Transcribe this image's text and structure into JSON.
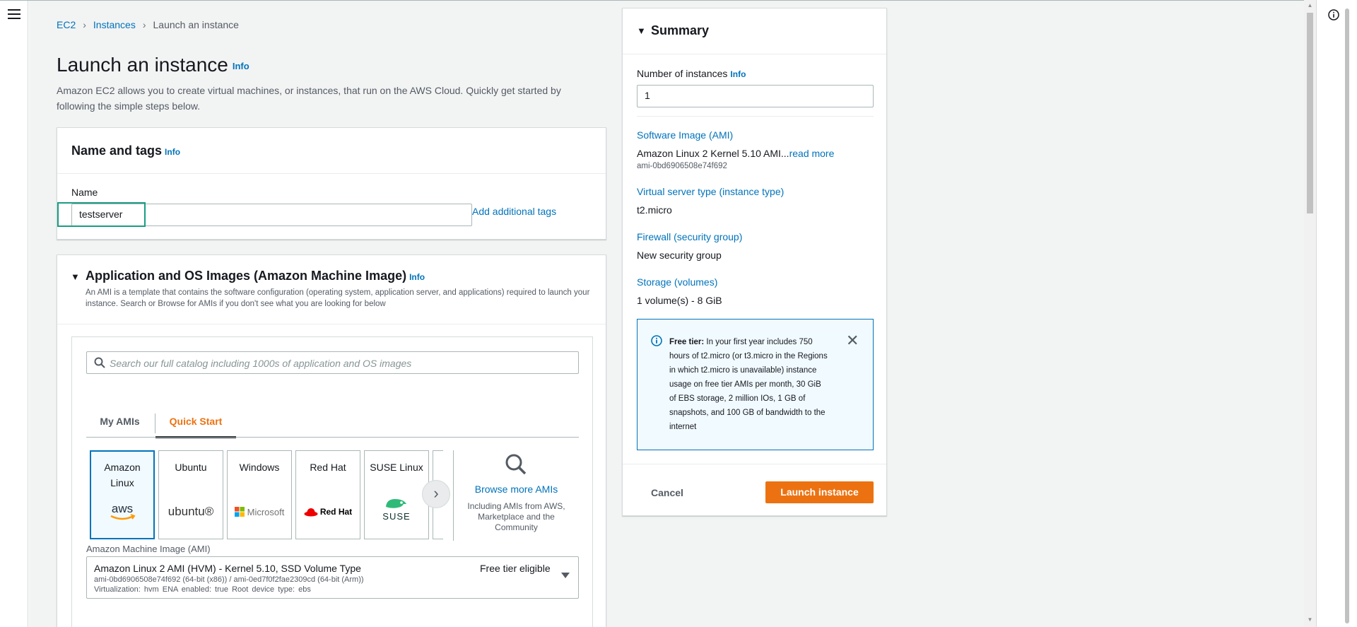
{
  "breadcrumb": {
    "items": [
      "EC2",
      "Instances"
    ],
    "current": "Launch an instance"
  },
  "page": {
    "title": "Launch an instance",
    "info": "Info",
    "intro": "Amazon EC2 allows you to create virtual machines, or instances, that run on the AWS Cloud. Quickly get started by following the simple steps below."
  },
  "name_tags": {
    "title": "Name and tags",
    "info": "Info",
    "name_label": "Name",
    "name_value": "testserver",
    "add_tags": "Add additional tags"
  },
  "ami_section": {
    "title": "Application and OS Images (Amazon Machine Image)",
    "info": "Info",
    "description": "An AMI is a template that contains the software configuration (operating system, application server, and applications) required to launch your instance. Search or Browse for AMIs if you don't see what you are looking for below",
    "search_placeholder": "Search our full catalog including 1000s of application and OS images",
    "tabs": [
      "My AMIs",
      "Quick Start"
    ],
    "active_tab": "Quick Start",
    "tiles": [
      {
        "label": "Amazon Linux",
        "logo": "aws",
        "selected": true
      },
      {
        "label": "Ubuntu",
        "logo": "ubuntu®",
        "selected": false
      },
      {
        "label": "Windows",
        "logo": "Microsoft",
        "selected": false
      },
      {
        "label": "Red Hat",
        "logo": "Red Hat",
        "selected": false
      },
      {
        "label": "SUSE Linux",
        "logo": "SUSE",
        "selected": false
      }
    ],
    "browse_link": "Browse more AMIs",
    "browse_desc": "Including AMIs from AWS, Marketplace and the Community",
    "ami_label": "Amazon Machine Image (AMI)",
    "ami_name": "Amazon Linux 2 AMI (HVM) - Kernel 5.10, SSD Volume Type",
    "ami_badge": "Free tier eligible",
    "ami_ids": "ami-0bd6906508e74f692 (64-bit (x86)) / ami-0ed7f0f2fae2309cd (64-bit (Arm))",
    "ami_meta": "Virtualization: hvm    ENA enabled: true    Root device type: ebs"
  },
  "summary": {
    "title": "Summary",
    "num_label": "Number of instances",
    "info": "Info",
    "num_value": "1",
    "software_key": "Software Image (AMI)",
    "software_val": "Amazon Linux 2 Kernel 5.10 AMI...",
    "read_more": "read more",
    "software_id": "ami-0bd6906508e74f692",
    "type_key": "Virtual server type (instance type)",
    "type_val": "t2.micro",
    "firewall_key": "Firewall (security group)",
    "firewall_val": "New security group",
    "storage_key": "Storage (volumes)",
    "storage_val": "1 volume(s) - 8 GiB",
    "free_tier_bold": "Free tier:",
    "free_tier_text": " In your first year includes 750 hours of t2.micro (or t3.micro in the Regions in which t2.micro is unavailable) instance usage on free tier AMIs per month, 30 GiB of EBS storage, 2 million IOs, 1 GB of snapshots, and 100 GB of bandwidth to the internet",
    "cancel": "Cancel",
    "launch": "Launch instance"
  },
  "colors": {
    "link": "#0073bb",
    "accent_orange": "#ec7211",
    "highlight_teal": "#1a9c85"
  }
}
